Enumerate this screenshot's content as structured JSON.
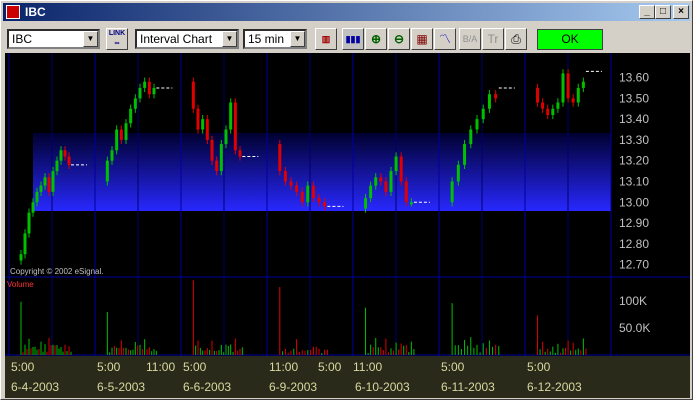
{
  "window": {
    "title": "IBC"
  },
  "toolbar": {
    "symbol": "IBC",
    "chart_type": "Interval Chart",
    "interval": "15 min",
    "link_label": "LINK",
    "ok_label": "OK",
    "buttons": [
      "bar-style",
      "volume-bars",
      "zoom-in",
      "zoom-out",
      "calendar",
      "indicators",
      "bid-ask",
      "trades",
      "print"
    ]
  },
  "copyright": "Copyright © 2002 eSignal.",
  "volume_label": "Volume",
  "colors": {
    "up": "#00c000",
    "down": "#e00000",
    "grid": "#0000a0",
    "price_text": "#c0c0c0",
    "band_top": "#000040",
    "band_bottom": "#2020ff"
  },
  "chart_data": {
    "type": "candlestick",
    "price_ticks": [
      "13.60",
      "13.50",
      "13.40",
      "13.30",
      "13.20",
      "13.10",
      "13.00",
      "12.90",
      "12.80",
      "12.70"
    ],
    "volume_ticks": [
      "100K",
      "50.0K"
    ],
    "x_time_labels": [
      "5:00",
      "5:00",
      "11:00",
      "5:00",
      "11:00",
      "5:00",
      "11:00",
      "5:00",
      "5:00",
      "5:00"
    ],
    "x_date_labels": [
      "6-4-2003",
      "6-5-2003",
      "6-6-2003",
      "6-9-2003",
      "6-10-2003",
      "6-11-2003",
      "6-12-2003"
    ],
    "ylim": [
      12.65,
      13.67
    ],
    "sessions": [
      {
        "date": "6-4-2003",
        "prices": [
          12.72,
          12.75,
          12.85,
          12.95,
          13.0,
          13.05,
          13.08,
          13.12,
          13.05,
          13.15,
          13.2,
          13.25,
          13.22,
          13.18
        ],
        "close_dash": 13.18
      },
      {
        "date": "6-5-2003",
        "prices": [
          13.1,
          13.2,
          13.25,
          13.35,
          13.3,
          13.38,
          13.45,
          13.5,
          13.55,
          13.58,
          13.52,
          13.55
        ],
        "close_dash": 13.55
      },
      {
        "date": "6-6-2003",
        "prices": [
          13.58,
          13.45,
          13.35,
          13.4,
          13.3,
          13.2,
          13.15,
          13.28,
          13.35,
          13.48,
          13.25,
          13.22
        ],
        "close_dash": 13.22
      },
      {
        "date": "6-9-2003",
        "prices": [
          13.28,
          13.15,
          13.1,
          13.08,
          13.05,
          13.0,
          13.08,
          13.02,
          13.0,
          12.98
        ],
        "close_dash": 12.98
      },
      {
        "date": "6-10-2003",
        "prices": [
          12.97,
          13.02,
          13.08,
          13.12,
          13.1,
          13.05,
          13.15,
          13.22,
          13.1,
          13.0,
          13.0
        ],
        "close_dash": 13.0
      },
      {
        "date": "6-11-2003",
        "prices": [
          13.0,
          13.1,
          13.18,
          13.28,
          13.35,
          13.4,
          13.45,
          13.52,
          13.5
        ],
        "close_dash": 13.55
      },
      {
        "date": "6-12-2003",
        "prices": [
          13.55,
          13.48,
          13.45,
          13.42,
          13.45,
          13.48,
          13.62,
          13.5,
          13.48,
          13.55,
          13.58
        ],
        "close_dash": 13.63
      }
    ]
  }
}
